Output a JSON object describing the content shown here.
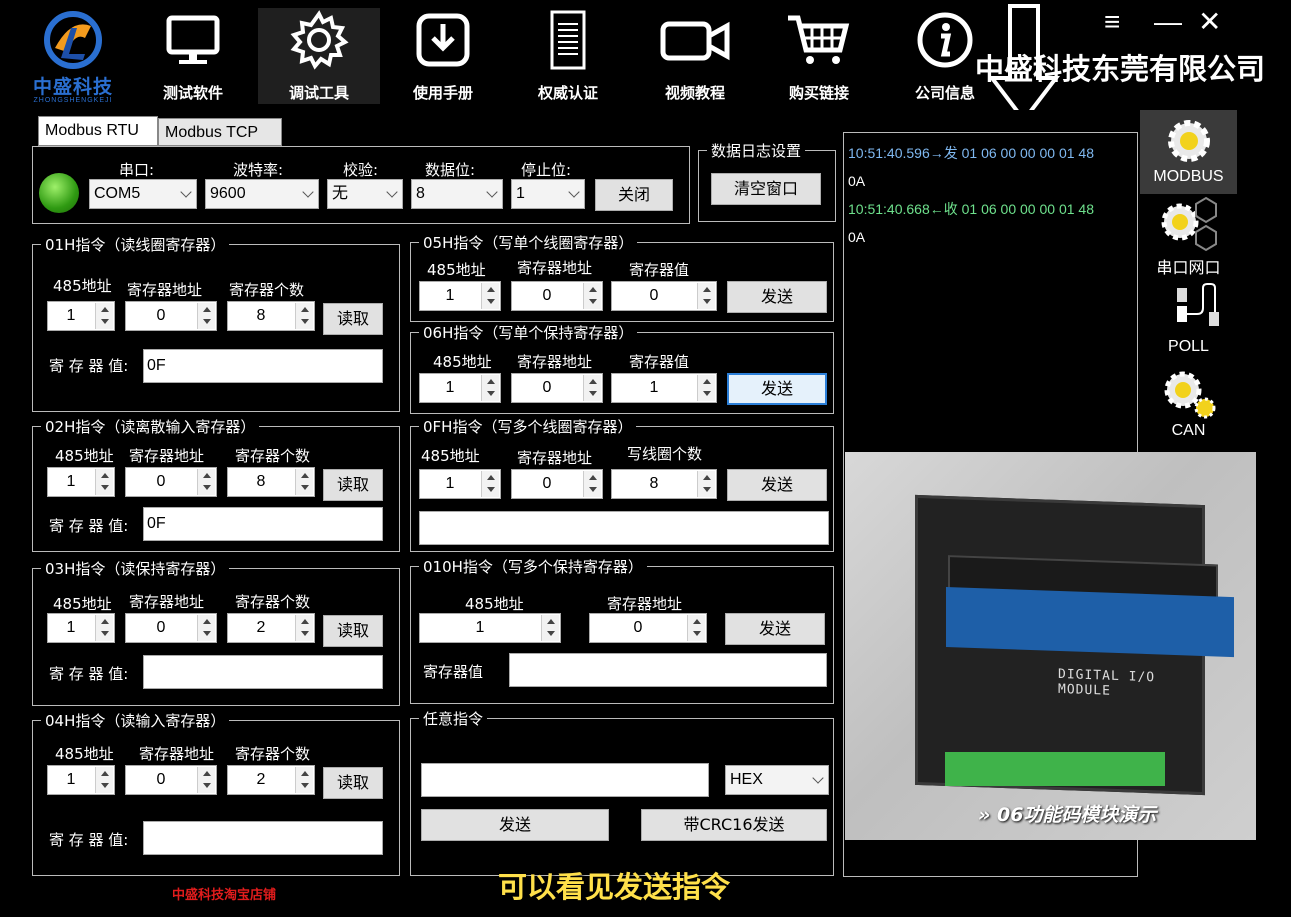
{
  "brand": {
    "name": "中盛科技",
    "sub": "ZHONGSHENGKEJI"
  },
  "nav": [
    {
      "label": "测试软件",
      "icon": "monitor-icon"
    },
    {
      "label": "调试工具",
      "icon": "gear-icon"
    },
    {
      "label": "使用手册",
      "icon": "download-icon"
    },
    {
      "label": "权威认证",
      "icon": "certificate-icon"
    },
    {
      "label": "视频教程",
      "icon": "video-camera-icon"
    },
    {
      "label": "购买链接",
      "icon": "cart-icon"
    },
    {
      "label": "公司信息",
      "icon": "info-icon"
    }
  ],
  "company": "中盛科技东莞有限公司",
  "tabs": [
    "Modbus RTU",
    "Modbus TCP"
  ],
  "serial": {
    "port_label": "串口:",
    "port": "COM5",
    "baud_label": "波特率:",
    "baud": "9600",
    "parity_label": "校验:",
    "parity": "无",
    "databits_label": "数据位:",
    "databits": "8",
    "stopbits_label": "停止位:",
    "stopbits": "1",
    "close": "关闭"
  },
  "log_settings": {
    "title": "数据日志设置",
    "clear": "清空窗口"
  },
  "log": {
    "l1": "10:51:40.596→发 01 06 00 00 00 01 48",
    "l1b": "0A",
    "l2": "10:51:40.668←收 01 06 00 00 00 01 48",
    "l2b": "0A"
  },
  "common": {
    "addr485": "485地址",
    "reg_addr": "寄存器地址",
    "reg_count": "寄存器个数",
    "reg_value": "寄存器值",
    "reg_value_colon": "寄 存 器 值:",
    "read": "读取",
    "send": "发送",
    "coil_count": "写线圈个数"
  },
  "f01": {
    "title": "01H指令（读线圈寄存器）",
    "addr": "1",
    "reg": "0",
    "count": "8",
    "value": "0F"
  },
  "f02": {
    "title": "02H指令（读离散输入寄存器）",
    "addr": "1",
    "reg": "0",
    "count": "8",
    "value": "0F"
  },
  "f03": {
    "title": "03H指令（读保持寄存器）",
    "addr": "1",
    "reg": "0",
    "count": "2",
    "value": ""
  },
  "f04": {
    "title": "04H指令（读输入寄存器）",
    "addr": "1",
    "reg": "0",
    "count": "2",
    "value": ""
  },
  "f05": {
    "title": "05H指令（写单个线圈寄存器）",
    "addr": "1",
    "reg": "0",
    "value": "0"
  },
  "f06": {
    "title": "06H指令（写单个保持寄存器）",
    "addr": "1",
    "reg": "0",
    "value": "1"
  },
  "f0f": {
    "title": "0FH指令（写多个线圈寄存器）",
    "addr": "1",
    "reg": "0",
    "count": "8",
    "data": ""
  },
  "f10": {
    "title": "010H指令（写多个保持寄存器）",
    "addr": "1",
    "reg": "0",
    "value": ""
  },
  "any": {
    "title": "任意指令",
    "input": "",
    "mode": "HEX",
    "send": "发送",
    "send_crc": "带CRC16发送"
  },
  "side": [
    "MODBUS",
    "串口网口",
    "POLL",
    "CAN"
  ],
  "video": {
    "module_label": "DIGITAL I/O MODULE",
    "caption": "06功能码模块演示"
  },
  "subtitle": "可以看见发送指令",
  "shop": "中盛科技淘宝店铺"
}
